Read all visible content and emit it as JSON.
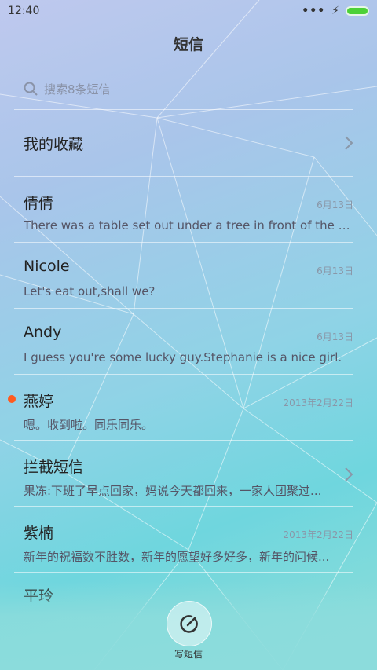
{
  "status_bar": {
    "time": "12:40",
    "signal": "•••",
    "charging": "⚡"
  },
  "title": "短信",
  "search": {
    "placeholder": "搜索8条短信"
  },
  "favorites": {
    "label": "我的收藏"
  },
  "messages": [
    {
      "name": "倩倩",
      "date": "6月13日",
      "preview": "There was a table set out under a tree in front of the ho..."
    },
    {
      "name": "Nicole",
      "date": "6月13日",
      "preview": "Let's eat out,shall we?"
    },
    {
      "name": "Andy",
      "date": "6月13日",
      "preview": "I guess you're some lucky guy.Stephanie is a nice girl."
    },
    {
      "name": "燕婷",
      "date": "2013年2月22日",
      "preview": "嗯。收到啦。同乐同乐。",
      "unread": true
    },
    {
      "name": "拦截短信",
      "date": "",
      "preview": "果冻:下班了早点回家，妈说今天都回来，一家人团聚过..."
    },
    {
      "name": "紫楠",
      "date": "2013年2月22日",
      "preview": "新年的祝福数不胜数，新年的愿望好多好多，新年的问候..."
    },
    {
      "name": "平玲",
      "date": "",
      "preview": ""
    }
  ],
  "compose": {
    "label": "写短信"
  },
  "colors": {
    "unread_dot": "#ff5a1f",
    "battery": "#4cd137"
  }
}
